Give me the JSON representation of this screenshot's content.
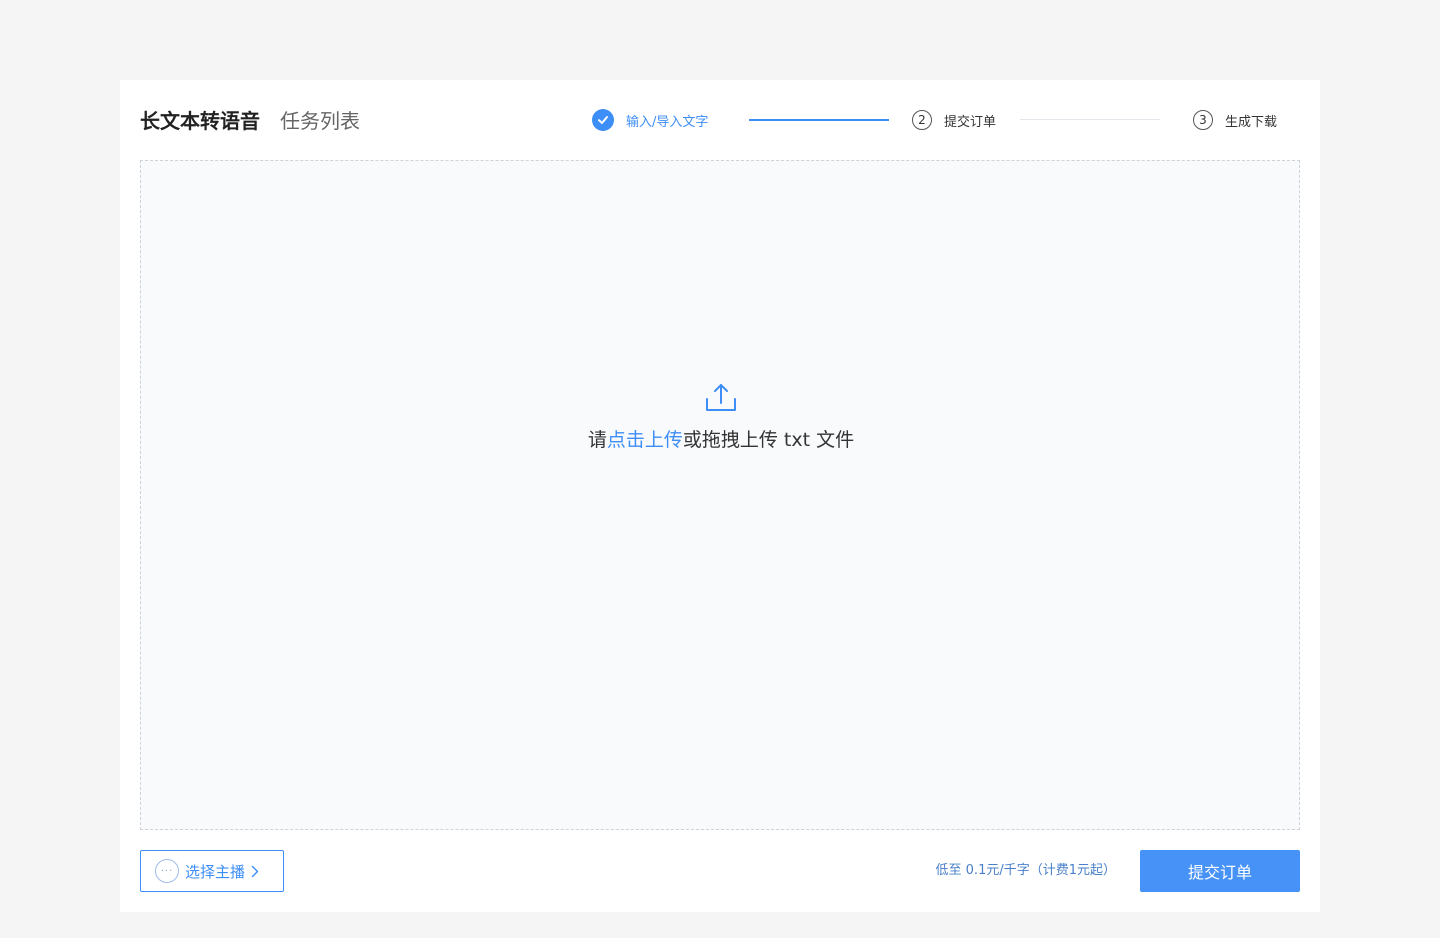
{
  "header": {
    "tab_main": "长文本转语音",
    "tab_secondary": "任务列表"
  },
  "steps": [
    {
      "number": "",
      "label": "输入/导入文字",
      "status": "done"
    },
    {
      "number": "2",
      "label": "提交订单",
      "status": "pending"
    },
    {
      "number": "3",
      "label": "生成下载",
      "status": "pending"
    }
  ],
  "upload": {
    "prefix": "请",
    "link": "点击上传",
    "suffix": "或拖拽上传 txt 文件",
    "icon": "upload-icon"
  },
  "footer": {
    "select_anchor_label": "选择主播",
    "price_note": "低至 0.1元/千字（计费1元起）",
    "submit_label": "提交订单"
  },
  "colors": {
    "accent": "#3e8ef7",
    "background": "#f5f5f5",
    "dropzone_bg": "#f8fafc"
  }
}
